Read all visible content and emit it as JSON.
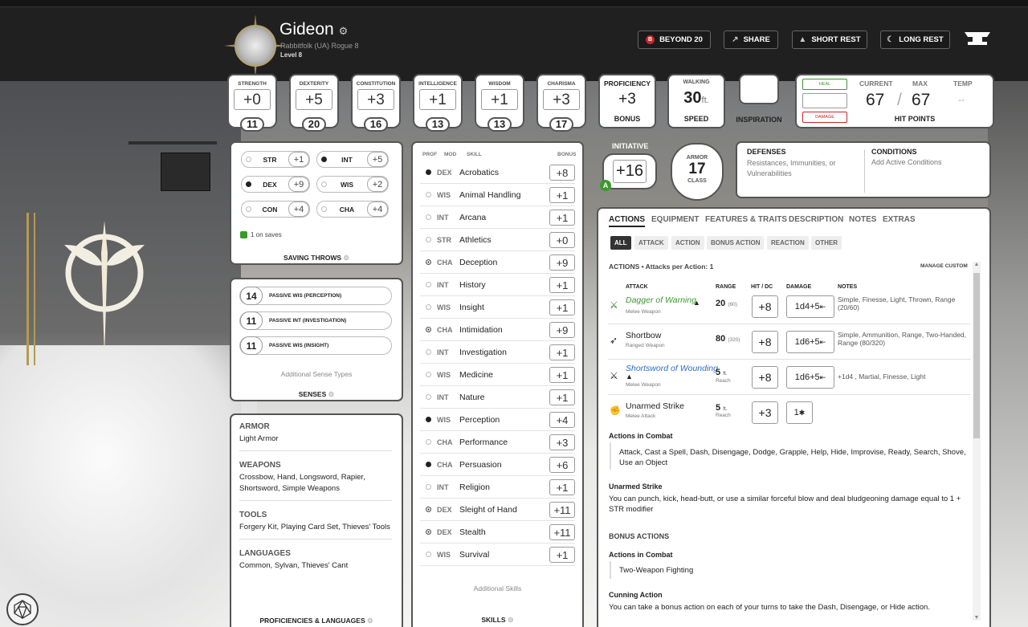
{
  "header": {
    "name": "Gideon",
    "subtitle": "Rabbitfolk (UA)  Rogue 8",
    "level": "Level 8",
    "buttons": [
      {
        "label": "BEYOND 20",
        "icon": "beyond20-icon"
      },
      {
        "label": "SHARE",
        "icon": "share-icon"
      },
      {
        "label": "SHORT REST",
        "icon": "short-rest-icon"
      },
      {
        "label": "LONG REST",
        "icon": "long-rest-icon"
      }
    ]
  },
  "abilities": [
    {
      "name": "STRENGTH",
      "mod": "+0",
      "score": "11"
    },
    {
      "name": "DEXTERITY",
      "mod": "+5",
      "score": "20"
    },
    {
      "name": "CONSTITUTION",
      "mod": "+3",
      "score": "16"
    },
    {
      "name": "INTELLIGENCE",
      "mod": "+1",
      "score": "13"
    },
    {
      "name": "WISDOM",
      "mod": "+1",
      "score": "13"
    },
    {
      "name": "CHARISMA",
      "mod": "+3",
      "score": "17"
    }
  ],
  "proficiency": {
    "label": "PROFICIENCY",
    "value": "+3",
    "sub": "BONUS"
  },
  "speed": {
    "label": "WALKING",
    "value": "30",
    "unit": "ft.",
    "sub": "SPEED"
  },
  "inspiration": {
    "label": "INSPIRATION"
  },
  "hp": {
    "heal": "HEAL",
    "damage": "DAMAGE",
    "current_label": "CURRENT",
    "max_label": "MAX",
    "temp_label": "TEMP",
    "current": "67",
    "max": "67",
    "temp": "--",
    "slash": "/",
    "title": "HIT POINTS"
  },
  "initiative": {
    "label": "INITIATIVE",
    "value": "+16",
    "badge": "A"
  },
  "armor": {
    "top": "ARMOR",
    "value": "17",
    "bottom": "CLASS"
  },
  "defenses": {
    "title": "DEFENSES",
    "text": "Resistances, Immunities, or Vulnerabilities"
  },
  "conditions": {
    "title": "CONDITIONS",
    "text": "Add Active Conditions"
  },
  "saves": {
    "rows": [
      {
        "abbr": "STR",
        "val": "+1"
      },
      {
        "abbr": "INT",
        "val": "+5"
      },
      {
        "abbr": "DEX",
        "val": "+9"
      },
      {
        "abbr": "WIS",
        "val": "+2"
      },
      {
        "abbr": "CON",
        "val": "+4"
      },
      {
        "abbr": "CHA",
        "val": "+4"
      }
    ],
    "note": "1 on saves",
    "title": "SAVING THROWS"
  },
  "senses": {
    "rows": [
      {
        "val": "14",
        "label": "PASSIVE WIS (PERCEPTION)"
      },
      {
        "val": "11",
        "label": "PASSIVE INT (INVESTIGATION)"
      },
      {
        "val": "11",
        "label": "PASSIVE WIS (INSIGHT)"
      }
    ],
    "additional": "Additional Sense Types",
    "title": "SENSES"
  },
  "proficiencies": {
    "armor_h": "ARMOR",
    "armor": "Light Armor",
    "weapons_h": "WEAPONS",
    "weapons": "Crossbow, Hand, Longsword, Rapier, Shortsword, Simple Weapons",
    "tools_h": "TOOLS",
    "tools": "Forgery Kit, Playing Card Set, Thieves' Tools",
    "languages_h": "LANGUAGES",
    "languages": "Common, Sylvan, Thieves' Cant",
    "title": "PROFICIENCIES & LANGUAGES"
  },
  "skills": {
    "headers": {
      "prof": "PROF",
      "mod": "MOD",
      "skill": "SKILL",
      "bonus": "BONUS"
    },
    "rows": [
      {
        "mod": "DEX",
        "name": "Acrobatics",
        "bonus": "+8",
        "prof": "prof"
      },
      {
        "mod": "WIS",
        "name": "Animal Handling",
        "bonus": "+1",
        "prof": "none"
      },
      {
        "mod": "INT",
        "name": "Arcana",
        "bonus": "+1",
        "prof": "none"
      },
      {
        "mod": "STR",
        "name": "Athletics",
        "bonus": "+0",
        "prof": "none"
      },
      {
        "mod": "CHA",
        "name": "Deception",
        "bonus": "+9",
        "prof": "exp"
      },
      {
        "mod": "INT",
        "name": "History",
        "bonus": "+1",
        "prof": "none"
      },
      {
        "mod": "WIS",
        "name": "Insight",
        "bonus": "+1",
        "prof": "none"
      },
      {
        "mod": "CHA",
        "name": "Intimidation",
        "bonus": "+9",
        "prof": "exp"
      },
      {
        "mod": "INT",
        "name": "Investigation",
        "bonus": "+1",
        "prof": "none"
      },
      {
        "mod": "WIS",
        "name": "Medicine",
        "bonus": "+1",
        "prof": "none"
      },
      {
        "mod": "INT",
        "name": "Nature",
        "bonus": "+1",
        "prof": "none"
      },
      {
        "mod": "WIS",
        "name": "Perception",
        "bonus": "+4",
        "prof": "prof"
      },
      {
        "mod": "CHA",
        "name": "Performance",
        "bonus": "+3",
        "prof": "none"
      },
      {
        "mod": "CHA",
        "name": "Persuasion",
        "bonus": "+6",
        "prof": "prof"
      },
      {
        "mod": "INT",
        "name": "Religion",
        "bonus": "+1",
        "prof": "none"
      },
      {
        "mod": "DEX",
        "name": "Sleight of Hand",
        "bonus": "+11",
        "prof": "exp"
      },
      {
        "mod": "DEX",
        "name": "Stealth",
        "bonus": "+11",
        "prof": "exp"
      },
      {
        "mod": "WIS",
        "name": "Survival",
        "bonus": "+1",
        "prof": "none"
      }
    ],
    "additional": "Additional Skills",
    "title": "SKILLS"
  },
  "tabs": [
    "ACTIONS",
    "EQUIPMENT",
    "FEATURES & TRAITS",
    "DESCRIPTION",
    "NOTES",
    "EXTRAS"
  ],
  "filters": [
    "ALL",
    "ATTACK",
    "ACTION",
    "BONUS ACTION",
    "REACTION",
    "OTHER"
  ],
  "actions": {
    "heading": "ACTIONS • Attacks per Action: 1",
    "manage": "MANAGE CUSTOM",
    "cols": {
      "attack": "ATTACK",
      "range": "RANGE",
      "hit": "HIT / DC",
      "damage": "DAMAGE",
      "notes": "NOTES"
    },
    "attacks": [
      {
        "name": "Dagger of Warning",
        "type": "Melee Weapon",
        "range": "20",
        "range2": "(60)",
        "hit": "+8",
        "damage": "1d4+5",
        "notes": "Simple, Finesse, Light, Thrown, Range (20/60)",
        "color": "#3a9a2c"
      },
      {
        "name": "Shortbow",
        "type": "Ranged Weapon",
        "range": "80",
        "range2": "(320)",
        "hit": "+8",
        "damage": "1d6+5",
        "notes": "Simple, Ammunition, Range, Two-Handed, Range (80/320)",
        "color": "#222222"
      },
      {
        "name": "Shortsword of Wounding",
        "type": "Melee Weapon",
        "range": "5",
        "range2": "ft.",
        "reach": "Reach",
        "hit": "+8",
        "damage": "1d6+5",
        "notes": "+1d4 , Martial, Finesse, Light",
        "color": "#2a6cc4"
      },
      {
        "name": "Unarmed Strike",
        "type": "Melee Attack",
        "range": "5",
        "range2": "ft.",
        "reach": "Reach",
        "hit": "+3",
        "damage": "1",
        "notes": "",
        "color": "#222222"
      }
    ],
    "combat_h": "Actions in Combat",
    "combat_text": "Attack, Cast a Spell, Dash, Disengage, Dodge, Grapple, Help, Hide, Improvise, Ready, Search, Shove, Use an Object",
    "unarmed_h": "Unarmed Strike",
    "unarmed_text": "You can punch, kick, head-butt, or use a similar forceful blow and deal bludgeoning damage equal to 1 + STR modifier",
    "bonus_h": "BONUS ACTIONS",
    "bonus_combat_h": "Actions in Combat",
    "bonus_combat_text": "Two-Weapon Fighting",
    "cunning_h": "Cunning Action",
    "cunning_text": "You can take a bonus action on each of your turns to take the Dash, Disengage, or Hide action."
  }
}
